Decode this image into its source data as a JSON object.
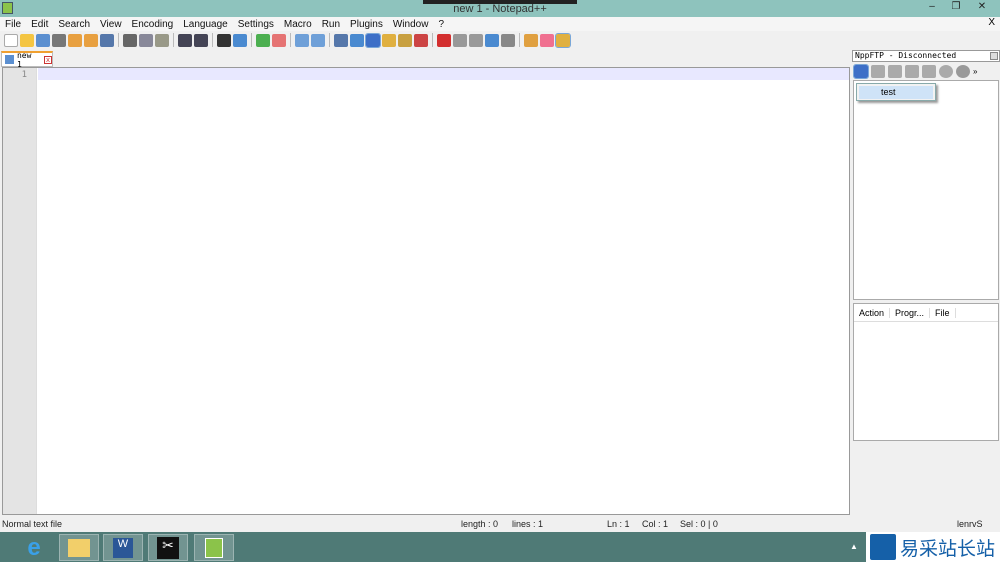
{
  "window": {
    "title": "new 1 - Notepad++",
    "minimize": "‒",
    "restore": "❐",
    "close": "✕"
  },
  "menu": {
    "items": [
      "File",
      "Edit",
      "Search",
      "View",
      "Encoding",
      "Language",
      "Settings",
      "Macro",
      "Run",
      "Plugins",
      "Window",
      "?"
    ],
    "close": "X"
  },
  "toolbar": {
    "icons": [
      "new",
      "open",
      "save",
      "save-all",
      "close",
      "close-all",
      "print",
      "|",
      "cut",
      "copy",
      "paste",
      "|",
      "undo",
      "redo",
      "|",
      "find",
      "replace",
      "|",
      "zoom-in",
      "zoom-out",
      "|",
      "sync-v",
      "sync-h",
      "|",
      "wrap",
      "show-all",
      "indent-guide",
      "udl",
      "doc-map",
      "function-list",
      "|",
      "record",
      "stop",
      "play",
      "play-multi",
      "save-macro",
      "|",
      "npp-export",
      "heart",
      "ftp"
    ],
    "colors": {
      "new": "#ffffff",
      "open": "#f4c542",
      "save": "#5b8fd0",
      "save-all": "#777",
      "close": "#e8a040",
      "close-all": "#e8a040",
      "print": "#5577aa",
      "cut": "#666",
      "copy": "#889",
      "paste": "#998",
      "undo": "#445",
      "redo": "#445",
      "find": "#333",
      "replace": "#4a8ad0",
      "zoom-in": "#4caf50",
      "zoom-out": "#e57373",
      "sync-v": "#6fa0d8",
      "sync-h": "#6fa0d8",
      "wrap": "#5577aa",
      "show-all": "#4a8ad0",
      "indent-guide": "#3d6fc7",
      "udl": "#e0b040",
      "doc-map": "#c8a040",
      "function-list": "#cc4444",
      "record": "#d32f2f",
      "stop": "#999",
      "play": "#999",
      "play-multi": "#4a8ad0",
      "save-macro": "#888",
      "npp-export": "#e0a040",
      "heart": "#f07090",
      "ftp": "#e0b040"
    },
    "active": [
      "indent-guide",
      "ftp"
    ]
  },
  "tab": {
    "label": "new 1"
  },
  "editor": {
    "line_numbers": [
      "1"
    ]
  },
  "nppftp": {
    "title": "NppFTP - Disconnected",
    "dropdown_item": "test",
    "queue_columns": [
      "Action",
      "Progr...",
      "File"
    ]
  },
  "status": {
    "file_type": "Normal text file",
    "length": "length : 0",
    "lines": "lines : 1",
    "ln": "Ln : 1",
    "col": "Col : 1",
    "sel": "Sel : 0 | 0",
    "extra": "lenrvS"
  },
  "taskbar": {
    "apps": [
      "internet-explorer",
      "file-explorer",
      "word",
      "snipping-tool",
      "notepad-plus-plus"
    ],
    "watermark": "易采站长站"
  }
}
